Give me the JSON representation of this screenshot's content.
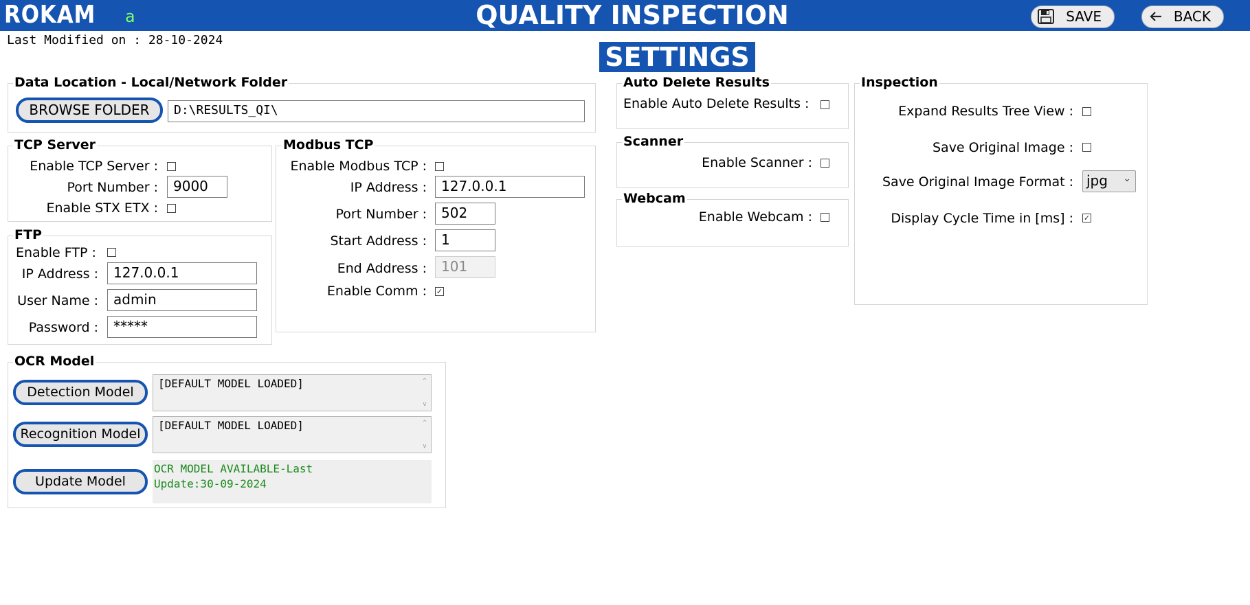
{
  "header": {
    "logo": "ROKAM",
    "user": "a",
    "title": "QUALITY INSPECTION",
    "save_label": "SAVE",
    "back_label": "BACK",
    "bar_color": "#1554b0"
  },
  "last_modified": "Last Modified on : 28-10-2024",
  "page_title": "SETTINGS",
  "data_location": {
    "legend": "Data Location - Local/Network Folder",
    "browse_label": "BROWSE FOLDER",
    "path_value": "D:\\RESULTS_QI\\"
  },
  "tcp_server": {
    "legend": "TCP Server",
    "enable_label": "Enable TCP Server :",
    "enable_checked": false,
    "port_label": "Port Number :",
    "port_value": "9000",
    "stx_label": "Enable STX ETX :",
    "stx_checked": false
  },
  "ftp": {
    "legend": "FTP",
    "enable_label": "Enable FTP :",
    "enable_checked": false,
    "ip_label": "IP Address :",
    "ip_value": "127.0.0.1",
    "user_label": "User Name :",
    "user_value": "admin",
    "password_label": "Password :",
    "password_value": "*****"
  },
  "modbus": {
    "legend": "Modbus TCP",
    "enable_label": "Enable Modbus TCP :",
    "enable_checked": false,
    "ip_label": "IP Address :",
    "ip_value": "127.0.0.1",
    "port_label": "Port Number :",
    "port_value": "502",
    "start_label": "Start Address :",
    "start_value": "1",
    "end_label": "End Address :",
    "end_value": "101",
    "comm_label": "Enable Comm :",
    "comm_checked": true
  },
  "ocr": {
    "legend": "OCR Model",
    "detection_label": "Detection Model",
    "detection_status": "[DEFAULT MODEL LOADED]",
    "recognition_label": "Recognition Model",
    "recognition_status": "[DEFAULT MODEL LOADED]",
    "update_label": "Update Model",
    "update_status_line1": "OCR MODEL AVAILABLE-Last",
    "update_status_line2": "Update:30-09-2024"
  },
  "auto_delete": {
    "legend": "Auto Delete Results",
    "enable_label": "Enable Auto Delete Results :",
    "enable_checked": false
  },
  "scanner": {
    "legend": "Scanner",
    "enable_label": "Enable Scanner :",
    "enable_checked": false
  },
  "webcam": {
    "legend": "Webcam",
    "enable_label": "Enable Webcam :",
    "enable_checked": false
  },
  "inspection": {
    "legend": "Inspection",
    "expand_label": "Expand Results Tree View :",
    "expand_checked": false,
    "save_orig_label": "Save Original Image :",
    "save_orig_checked": false,
    "format_label": "Save Original Image Format :",
    "format_value": "jpg",
    "cycle_label": "Display Cycle Time in [ms] :",
    "cycle_checked": true
  }
}
